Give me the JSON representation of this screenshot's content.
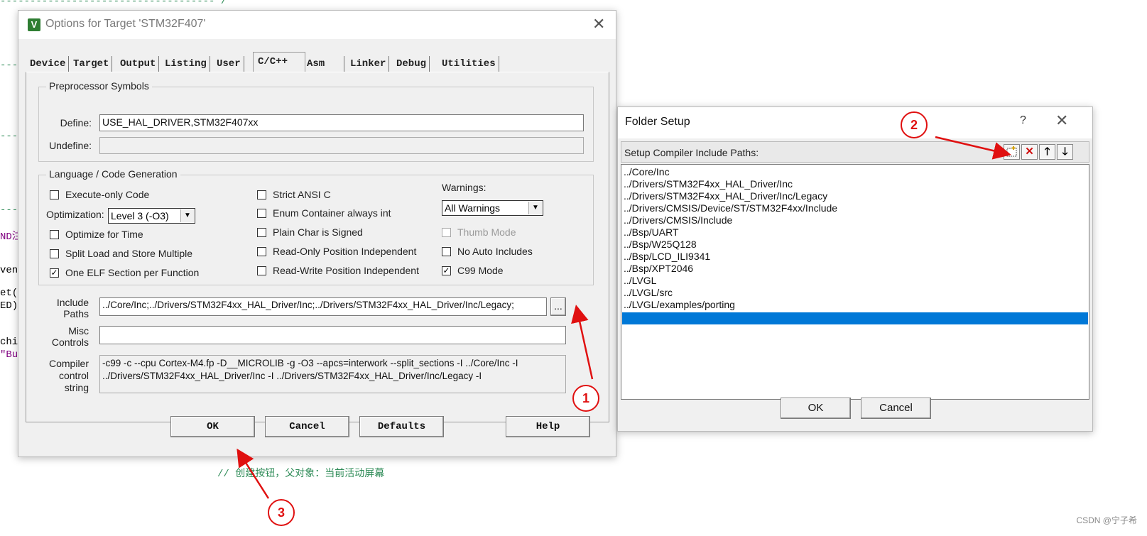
{
  "background": {
    "code_lines": [
      {
        "text": "------------------------------------*/",
        "cls": "dash"
      },
      {
        "text": "---",
        "cls": "dash"
      },
      {
        "text": "---",
        "cls": "dash"
      },
      {
        "text": "---",
        "cls": "dash"
      },
      {
        "text": "ND注",
        "cls": "purple"
      },
      {
        "text": "ven",
        "cls": ""
      },
      {
        "text": "et(",
        "cls": ""
      },
      {
        "text": "ED)",
        "cls": ""
      },
      {
        "text": "chi",
        "cls": ""
      },
      {
        "text": "\"Bu",
        "cls": "purple"
      },
      {
        "text": "// 创建按钮，父对象：当前活动屏幕",
        "cls": "dash"
      }
    ]
  },
  "options_dialog": {
    "title": "Options for Target 'STM32F407'",
    "tabs": [
      "Device",
      "Target",
      "Output",
      "Listing",
      "User",
      "C/C++",
      "Asm",
      "Linker",
      "Debug",
      "Utilities"
    ],
    "active_tab": "C/C++",
    "preprocessor": {
      "group_title": "Preprocessor Symbols",
      "define_label": "Define:",
      "define_value": "USE_HAL_DRIVER,STM32F407xx",
      "undefine_label": "Undefine:",
      "undefine_value": ""
    },
    "language": {
      "group_title": "Language / Code Generation",
      "execute_only": {
        "label": "Execute-only Code",
        "checked": false
      },
      "optimization_label": "Optimization:",
      "optimization_value": "Level 3 (-O3)",
      "optimize_time": {
        "label": "Optimize for Time",
        "checked": false
      },
      "split_load": {
        "label": "Split Load and Store Multiple",
        "checked": false
      },
      "one_elf": {
        "label": "One ELF Section per Function",
        "checked": true
      },
      "strict_ansi": {
        "label": "Strict ANSI C",
        "checked": false
      },
      "enum_container": {
        "label": "Enum Container always int",
        "checked": false
      },
      "plain_char": {
        "label": "Plain Char is Signed",
        "checked": false
      },
      "ropi": {
        "label": "Read-Only Position Independent",
        "checked": false
      },
      "rwpi": {
        "label": "Read-Write Position Independent",
        "checked": false
      },
      "warnings_label": "Warnings:",
      "warnings_value": "All Warnings",
      "thumb_mode": {
        "label": "Thumb Mode",
        "checked": false
      },
      "no_auto_includes": {
        "label": "No Auto Includes",
        "checked": false
      },
      "c99_mode": {
        "label": "C99 Mode",
        "checked": true
      }
    },
    "include_paths_label_1": "Include",
    "include_paths_label_2": "Paths",
    "include_paths_value": "../Core/Inc;../Drivers/STM32F4xx_HAL_Driver/Inc;../Drivers/STM32F4xx_HAL_Driver/Inc/Legacy;",
    "browse_button": "...",
    "misc_label_1": "Misc",
    "misc_label_2": "Controls",
    "misc_value": "",
    "compiler_label_1": "Compiler",
    "compiler_label_2": "control",
    "compiler_label_3": "string",
    "compiler_line_1": "-c99 -c --cpu Cortex-M4.fp -D__MICROLIB -g -O3 --apcs=interwork --split_sections -I ../Core/Inc -I",
    "compiler_line_2": "../Drivers/STM32F4xx_HAL_Driver/Inc -I ../Drivers/STM32F4xx_HAL_Driver/Inc/Legacy -I",
    "buttons": {
      "ok": "OK",
      "cancel": "Cancel",
      "defaults": "Defaults",
      "help": "Help"
    }
  },
  "folder_dialog": {
    "title": "Folder Setup",
    "help": "?",
    "header": "Setup Compiler Include Paths:",
    "toolbar_icons": [
      "new-folder-icon",
      "delete-icon",
      "move-up-icon",
      "move-down-icon"
    ],
    "paths": [
      "../Core/Inc",
      "../Drivers/STM32F4xx_HAL_Driver/Inc",
      "../Drivers/STM32F4xx_HAL_Driver/Inc/Legacy",
      "../Drivers/CMSIS/Device/ST/STM32F4xx/Include",
      "../Drivers/CMSIS/Include",
      "../Bsp/UART",
      "../Bsp/W25Q128",
      "../Bsp/LCD_ILI9341",
      "../Bsp/XPT2046",
      "../LVGL",
      "../LVGL/src",
      "../LVGL/examples/porting"
    ],
    "buttons": {
      "ok": "OK",
      "cancel": "Cancel"
    }
  },
  "annotations": {
    "a1": "1",
    "a2": "2",
    "a3": "3",
    "color": "#e01010"
  },
  "watermark": "CSDN @宁子希"
}
